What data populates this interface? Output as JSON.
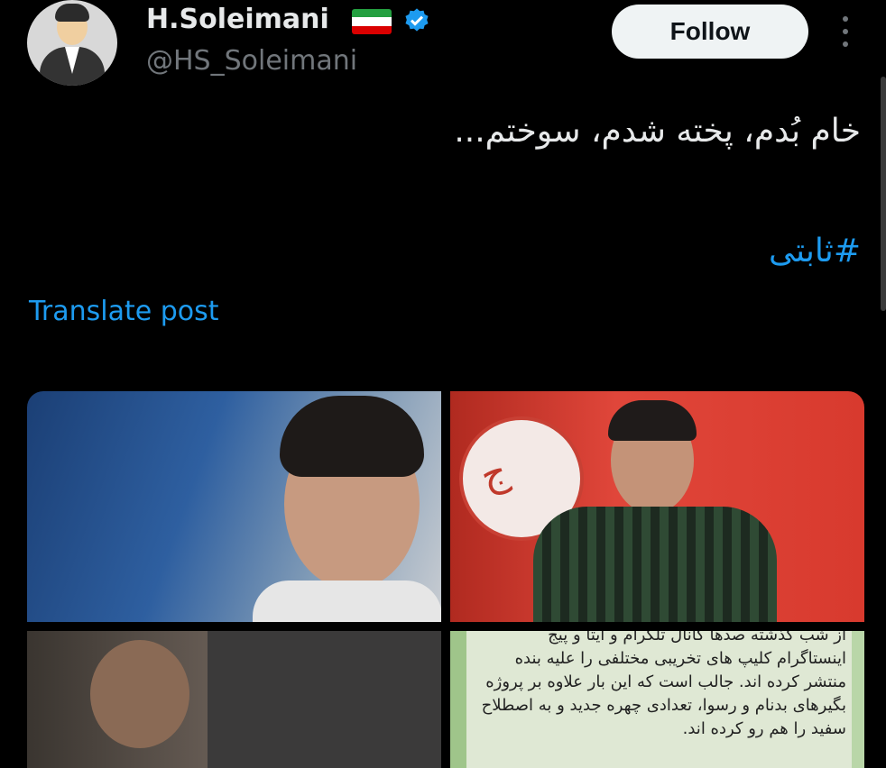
{
  "profile": {
    "name": "H.Soleimani",
    "handle": "@HS_Soleimani",
    "flag_icon": "iran-flag-icon",
    "verified_icon": "verified-badge-icon"
  },
  "actions": {
    "follow_label": "Follow",
    "more_icon": "more-options-icon"
  },
  "post": {
    "text": "خام بُدم، پخته شدم، سوختم...",
    "hashtag": "#ثابتی",
    "translate_label": "Translate post"
  },
  "media": {
    "image4_text": "از شب گذشته صدها کانال تلگرام و ایتا و پیج اینستاگرام کلیپ های تخریبی مختلفی را علیه بنده منتشر کرده اند. جالب است که این بار علاوه بر پروژه بگیرهای بدنام و رسوا، تعدادی چهره جدید و به اصطلاح سفید را هم رو کرده اند."
  },
  "colors": {
    "background": "#000000",
    "link": "#1d9bf0",
    "follow_bg": "#eff3f4",
    "secondary_text": "#71767b"
  }
}
